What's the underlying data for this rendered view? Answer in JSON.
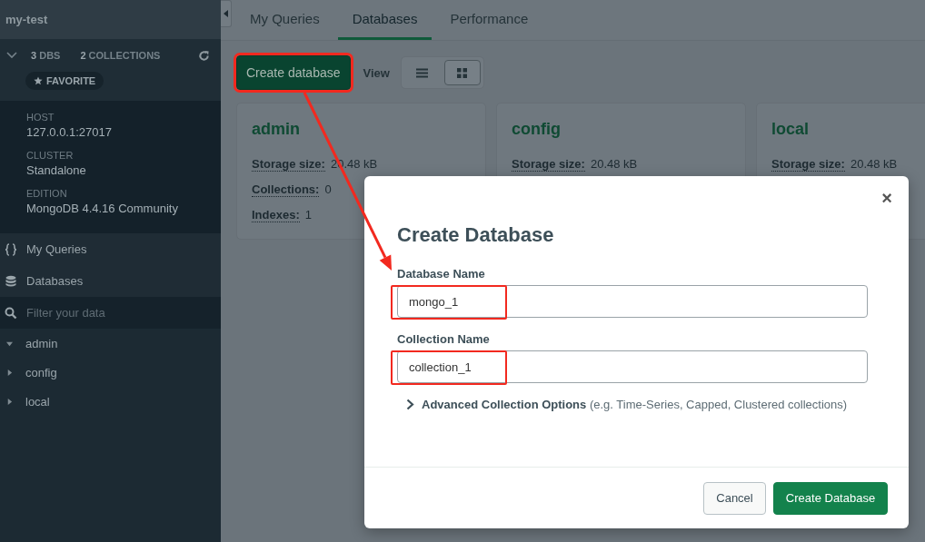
{
  "sidebar": {
    "connection_name": "my-test",
    "stats": [
      {
        "text": "**3** DBS"
      },
      {
        "text": "**2** COLLECTIONS"
      }
    ],
    "expanded": true,
    "favorite_button": "FAVORITE",
    "info": [
      {
        "label": "HOST",
        "value": "127.0.0.1:27017"
      },
      {
        "label": "CLUSTER",
        "value": "Standalone"
      },
      {
        "label": "EDITION",
        "value": "MongoDB 4.4.16 Community"
      }
    ],
    "nav": [
      {
        "kind": "queries",
        "label": "My Queries"
      },
      {
        "kind": "databases",
        "label": "Databases"
      }
    ],
    "filter": {
      "placeholder": "Filter your data"
    },
    "tree": [
      {
        "label": "admin",
        "expanded": true
      },
      {
        "label": "config",
        "expanded": false
      },
      {
        "label": "local",
        "expanded": false
      }
    ]
  },
  "tabs": [
    {
      "label": "My Queries",
      "selected": false
    },
    {
      "label": "Databases",
      "selected": true
    },
    {
      "label": "Performance",
      "selected": false
    }
  ],
  "toolbar": {
    "create_button": "Create database",
    "highlighted": true,
    "view_label": "View",
    "view_options": [
      {
        "kind": "list",
        "selected": false
      },
      {
        "kind": "grid",
        "selected": true
      }
    ]
  },
  "databases": [
    {
      "name": "admin",
      "stats": [
        {
          "label": "Storage size:",
          "value": "20.48 kB"
        },
        {
          "label": "Collections:",
          "value": "0"
        },
        {
          "label": "Indexes:",
          "value": "1"
        }
      ]
    },
    {
      "name": "config",
      "stats": [
        {
          "label": "Storage size:",
          "value": "20.48 kB"
        }
      ]
    },
    {
      "name": "local",
      "stats": [
        {
          "label": "Storage size:",
          "value": "20.48 kB"
        }
      ]
    }
  ],
  "dialog": {
    "title": "Create Database",
    "close": "×",
    "fields": [
      {
        "label": "Database Name",
        "value": "mongo_1",
        "highlighted": true
      },
      {
        "label": "Collection Name",
        "value": "collection_1",
        "highlighted": true
      }
    ],
    "advanced": {
      "text": "**Advanced Collection Options** (e.g. Time-Series, Capped, Clustered collections)",
      "expanded": false
    },
    "buttons": [
      {
        "kind": "secondary",
        "label": "Cancel"
      },
      {
        "kind": "primary",
        "label": "Create Database"
      }
    ]
  },
  "callout_arrow": true
}
